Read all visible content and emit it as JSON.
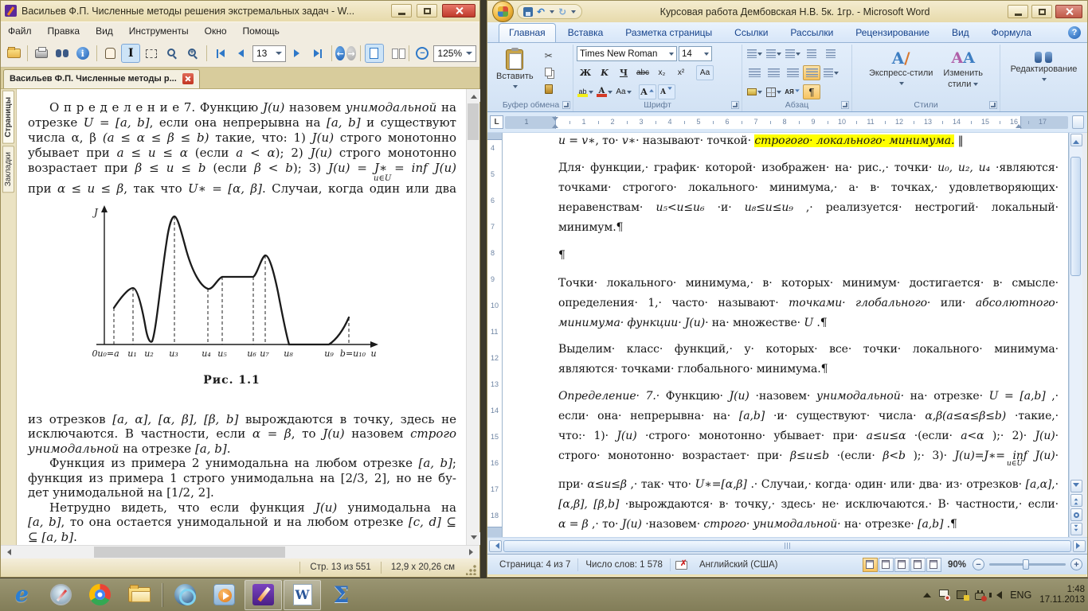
{
  "djvu": {
    "title": "Васильев Ф.П. Численные методы решения экстремальных задач - W...",
    "menu": [
      "Файл",
      "Правка",
      "Вид",
      "Инструменты",
      "Окно",
      "Помощь"
    ],
    "page_field": "13",
    "zoom_field": "125%",
    "tab": "Васильев Ф.П. Численные методы р...",
    "sidebar_tabs": [
      "Страницы",
      "Закладки"
    ],
    "status": {
      "page": "Стр. 13 из 551",
      "size": "12,9 x 20,26 см"
    },
    "book": {
      "inf_sub": "u∈U",
      "para1": [
        {
          "j": 1,
          "ind": 1,
          "seg": [
            [
              "n",
              "О п р е д е л е н и е  7.  Функцию "
            ],
            [
              "m",
              "J(u)"
            ],
            [
              "n",
              " назовем "
            ],
            [
              "i",
              "унимодальной"
            ],
            [
              "n",
              " на"
            ]
          ]
        },
        {
          "j": 1,
          "seg": [
            [
              "n",
              "отрезке "
            ],
            [
              "m",
              "U = [a, b]"
            ],
            [
              "n",
              ", если она непрерывна на "
            ],
            [
              "m",
              "[a, b]"
            ],
            [
              "n",
              " и существуют"
            ]
          ]
        },
        {
          "j": 1,
          "seg": [
            [
              "n",
              "числа α, β "
            ],
            [
              "m",
              "(a ≤ α ≤ β ≤ b)"
            ],
            [
              "n",
              " такие, что: 1) "
            ],
            [
              "m",
              "J(u)"
            ],
            [
              "n",
              " строго монотонно"
            ]
          ]
        },
        {
          "j": 1,
          "seg": [
            [
              "n",
              "убывает при "
            ],
            [
              "m",
              "a ≤ u ≤ α"
            ],
            [
              "n",
              " (если "
            ],
            [
              "m",
              "a < α"
            ],
            [
              "n",
              "); 2) "
            ],
            [
              "m",
              "J(u)"
            ],
            [
              "n",
              " строго монотонно"
            ]
          ]
        },
        {
          "j": 1,
          "seg": [
            [
              "n",
              "возрастает при "
            ],
            [
              "m",
              "β ≤ u ≤ b"
            ],
            [
              "n",
              " (если "
            ],
            [
              "m",
              "β < b"
            ],
            [
              "n",
              "); 3) "
            ],
            [
              "m",
              "J(u) = J∗ = inf J(u)"
            ]
          ]
        },
        {
          "j": 1,
          "seg": [
            [
              "n",
              "при "
            ],
            [
              "m",
              "α ≤ u ≤ β"
            ],
            [
              "n",
              ", так что "
            ],
            [
              "m",
              "U∗ = [α, β]"
            ],
            [
              "n",
              ".  Случаи, когда один или два"
            ]
          ]
        }
      ],
      "figure": {
        "ylabel": "J",
        "xlabels": [
          "0",
          "u₀=a",
          "u₁",
          "u₂",
          "u₃",
          "u₄",
          "u₅",
          "u₆",
          "u₇",
          "u₈",
          "u₉",
          "b=u₁₀",
          "u"
        ],
        "caption": "Рис. 1.1"
      },
      "para2": [
        {
          "j": 1,
          "seg": [
            [
              "n",
              "из отрезков "
            ],
            [
              "m",
              "[a, α], [α, β], [β, b]"
            ],
            [
              "n",
              " вырождаются в точку, здесь не"
            ]
          ]
        },
        {
          "j": 1,
          "seg": [
            [
              "n",
              "исключаются. В частности, если "
            ],
            [
              "m",
              "α = β"
            ],
            [
              "n",
              ", то "
            ],
            [
              "m",
              "J(u)"
            ],
            [
              "n",
              " назовем "
            ],
            [
              "i",
              "строго"
            ]
          ]
        },
        {
          "j": 0,
          "seg": [
            [
              "i",
              "унимодальной"
            ],
            [
              "n",
              " на отрезке "
            ],
            [
              "m",
              "[a, b]"
            ],
            [
              "n",
              "."
            ]
          ]
        },
        {
          "j": 1,
          "ind": 1,
          "seg": [
            [
              "n",
              "Функция из примера 2 унимодальна на любом отрезке "
            ],
            [
              "m",
              "[a, b]"
            ],
            [
              "n",
              ";"
            ]
          ]
        },
        {
          "j": 1,
          "seg": [
            [
              "n",
              "функция из примера 1 строго унимодальна на [2/3, 2], но не бу-"
            ]
          ]
        },
        {
          "j": 0,
          "seg": [
            [
              "n",
              "дет унимодальной на [1/2, 2]."
            ]
          ]
        },
        {
          "j": 1,
          "ind": 1,
          "seg": [
            [
              "n",
              "Нетрудно видеть, что если функция "
            ],
            [
              "m",
              "J(u)"
            ],
            [
              "n",
              " унимодальна на"
            ]
          ]
        },
        {
          "j": 1,
          "seg": [
            [
              "m",
              "[a, b]"
            ],
            [
              "n",
              ", то она остается унимодальной и на любом отрезке "
            ],
            [
              "m",
              "[c, d]"
            ],
            [
              "n",
              " ⊆"
            ]
          ]
        },
        {
          "j": 0,
          "seg": [
            [
              "n",
              "⊆ "
            ],
            [
              "m",
              "[a, b]"
            ],
            [
              "n",
              "."
            ]
          ]
        }
      ]
    }
  },
  "word": {
    "title": "Курсовая работа Дембовская Н.В. 5к. 1гр. - Microsoft Word",
    "tabs": [
      "Главная",
      "Вставка",
      "Разметка страницы",
      "Ссылки",
      "Рассылки",
      "Рецензирование",
      "Вид",
      "Формула"
    ],
    "active_tab": "Главная",
    "ribbon": {
      "paste": "Вставить",
      "clipboard_label": "Буфер обмена",
      "font_name": "Times New Roman",
      "font_size": "14",
      "font_label": "Шрифт",
      "fx": {
        "bold": "Ж",
        "italic": "K",
        "underline": "Ч",
        "strike": "abc",
        "sub": "x₂",
        "sup": "x²",
        "clear": "Аа",
        "highlight": "ab",
        "color": "А",
        "case": "Aa",
        "grow": "А",
        "shrink": "А"
      },
      "paragraph_label": "Абзац",
      "sort": "АЯ",
      "pilcrow": "¶",
      "quick_styles": "Экспресс-стили",
      "change_styles_1": "Изменить",
      "change_styles_2": "стили",
      "styles_label": "Стили",
      "editing_label": "Редактирование"
    },
    "hruler_left": [
      "2",
      "1"
    ],
    "hruler": [
      "1",
      "2",
      "3",
      "4",
      "5",
      "6",
      "7",
      "8",
      "9",
      "10",
      "11",
      "12",
      "13",
      "14",
      "15",
      "16",
      "17"
    ],
    "vruler": [
      "4",
      "5",
      "6",
      "7",
      "8",
      "9",
      "10",
      "11",
      "12",
      "13",
      "14",
      "15",
      "16",
      "17",
      "18"
    ],
    "doc": {
      "inf_sub": "u∈U",
      "lines": [
        {
          "j": 0,
          "seg": [
            [
              "m",
              "u = v∗"
            ],
            [
              "n",
              ", то· "
            ],
            [
              "m",
              "v∗"
            ],
            [
              "n",
              "· называют· точкой· "
            ],
            [
              "h",
              "строгого· локального· минимума."
            ],
            [
              "n",
              " ‖"
            ]
          ]
        },
        {
          "j": 1,
          "seg": [
            [
              "n",
              "Для· функции,· график· которой· изображен· на· рис.,· точки· "
            ],
            [
              "m",
              "u₀, u₂, u₄"
            ],
            [
              "n",
              " ·являются·"
            ]
          ]
        },
        {
          "j": 1,
          "seg": [
            [
              "n",
              "точками· строгого· локального· минимума,· а· в· точках,· удовлетворяющих·"
            ]
          ]
        },
        {
          "j": 1,
          "seg": [
            [
              "n",
              "неравенствам· "
            ],
            [
              "m",
              "u₅<u≤u₆"
            ],
            [
              "n",
              " ·и· "
            ],
            [
              "m",
              "u₈≤u≤u₉"
            ],
            [
              "n",
              " ,· реализуется· нестрогий· локальный·"
            ]
          ]
        },
        {
          "j": 0,
          "seg": [
            [
              "n",
              "минимум.¶"
            ]
          ]
        },
        {
          "j": 0,
          "seg": [
            [
              "n",
              "¶"
            ]
          ]
        },
        {
          "j": 1,
          "seg": [
            [
              "n",
              "Точки· локального· минимума,· в· которых· минимум· достигается· в· смысле·"
            ]
          ]
        },
        {
          "j": 1,
          "seg": [
            [
              "n",
              "определения· 1,· часто· называют· "
            ],
            [
              "i",
              "точками· глобального·"
            ],
            [
              "n",
              " или· "
            ],
            [
              "i",
              "абсолютного·"
            ]
          ]
        },
        {
          "j": 0,
          "seg": [
            [
              "i",
              "минимума· функции· "
            ],
            [
              "m",
              "J(u)"
            ],
            [
              "n",
              "· на· множестве· "
            ],
            [
              "m",
              "U"
            ],
            [
              "n",
              " .¶"
            ]
          ]
        },
        {
          "j": 1,
          "seg": [
            [
              "n",
              "Выделим· класс· функций,· у· которых· все· точки· локального· минимума·"
            ]
          ]
        },
        {
          "j": 0,
          "seg": [
            [
              "n",
              "являются· точками· глобального· минимума.¶"
            ]
          ]
        },
        {
          "j": 1,
          "seg": [
            [
              "i",
              "Определение· 7.·"
            ],
            [
              "n",
              " Функцию· "
            ],
            [
              "m",
              "J(u)"
            ],
            [
              "n",
              " ·назовем· "
            ],
            [
              "i",
              "унимодальной·"
            ],
            [
              "n",
              " на· отрезке· "
            ],
            [
              "m",
              "U = [a,b]"
            ],
            [
              "n",
              " ,·"
            ]
          ]
        },
        {
          "j": 1,
          "seg": [
            [
              "n",
              "если· она· непрерывна· на· "
            ],
            [
              "m",
              "[a,b]"
            ],
            [
              "n",
              " ·и· существуют· числа· "
            ],
            [
              "m",
              "α,β(a≤α≤β≤b)"
            ],
            [
              "n",
              " ·такие,·"
            ]
          ]
        },
        {
          "j": 1,
          "seg": [
            [
              "n",
              "что:· 1)· "
            ],
            [
              "m",
              "J(u)"
            ],
            [
              "n",
              " ·строго· монотонно· убывает· при· "
            ],
            [
              "m",
              "a≤u≤α"
            ],
            [
              "n",
              " ·(если· "
            ],
            [
              "m",
              "a<α"
            ],
            [
              "n",
              " );· 2)· "
            ],
            [
              "m",
              "J(u)"
            ],
            [
              "n",
              "·"
            ]
          ]
        },
        {
          "j": 1,
          "seg": [
            [
              "n",
              "строго· монотонно· возрастает· при· "
            ],
            [
              "m",
              "β≤u≤b"
            ],
            [
              "n",
              " ·(если· "
            ],
            [
              "m",
              "β<b"
            ],
            [
              "n",
              " );· 3)· "
            ],
            [
              "m",
              "J(u)=J∗= inf J(u)"
            ],
            [
              "n",
              "·"
            ]
          ]
        },
        {
          "j": 1,
          "seg": [
            [
              "n",
              "при· "
            ],
            [
              "m",
              "α≤u≤β"
            ],
            [
              "n",
              " ,· так· что· "
            ],
            [
              "m",
              "U∗=[α,β]"
            ],
            [
              "n",
              " .· Случаи,· когда· один· или· два· из· отрезков· "
            ],
            [
              "m",
              "[a,α]"
            ],
            [
              "n",
              ",·"
            ]
          ]
        },
        {
          "j": 1,
          "seg": [
            [
              "m",
              "[α,β], [β,b]"
            ],
            [
              "n",
              " ·вырождаются· в· точку,· здесь· не· исключаются.· В· частности,· если·"
            ]
          ]
        },
        {
          "j": 0,
          "seg": [
            [
              "m",
              "α = β"
            ],
            [
              "n",
              " ,· то· "
            ],
            [
              "m",
              "J(u)"
            ],
            [
              "n",
              " ·назовем· "
            ],
            [
              "i",
              "строго· унимодальной·"
            ],
            [
              "n",
              " на· отрезке· "
            ],
            [
              "m",
              "[a,b]"
            ],
            [
              "n",
              " .¶"
            ]
          ]
        }
      ]
    },
    "status": {
      "page": "Страница: 4 из 7",
      "words": "Число слов: 1 578",
      "lang": "Английский (США)",
      "zoom": "90%"
    }
  },
  "taskbar": {
    "icons": [
      {
        "name": "internet-explorer-icon",
        "cls": "ic-ie",
        "text": "e",
        "active": false
      },
      {
        "name": "safari-icon",
        "cls": "ic-safari",
        "text": "",
        "active": false
      },
      {
        "name": "chrome-icon",
        "cls": "ic-chrome",
        "text": "",
        "active": false
      },
      {
        "name": "file-explorer-icon",
        "cls": "ic-expl",
        "text": "",
        "active": false,
        "sep_after": true
      },
      {
        "name": "media-app-icon",
        "cls": "ic-bluecirc",
        "text": "",
        "active": false
      },
      {
        "name": "media-player-icon",
        "cls": "ic-player",
        "text": "",
        "active": false
      },
      {
        "name": "windjview-icon",
        "cls": "ic-djvu",
        "text": "",
        "active": true
      },
      {
        "name": "word-icon",
        "cls": "ic-word",
        "text": "W",
        "active": true
      },
      {
        "name": "mathtype-icon",
        "cls": "ic-sigma",
        "text": "Σ",
        "active": false
      }
    ],
    "tray": {
      "lang": "ENG",
      "time": "1:48",
      "date": "17.11.2013"
    }
  }
}
